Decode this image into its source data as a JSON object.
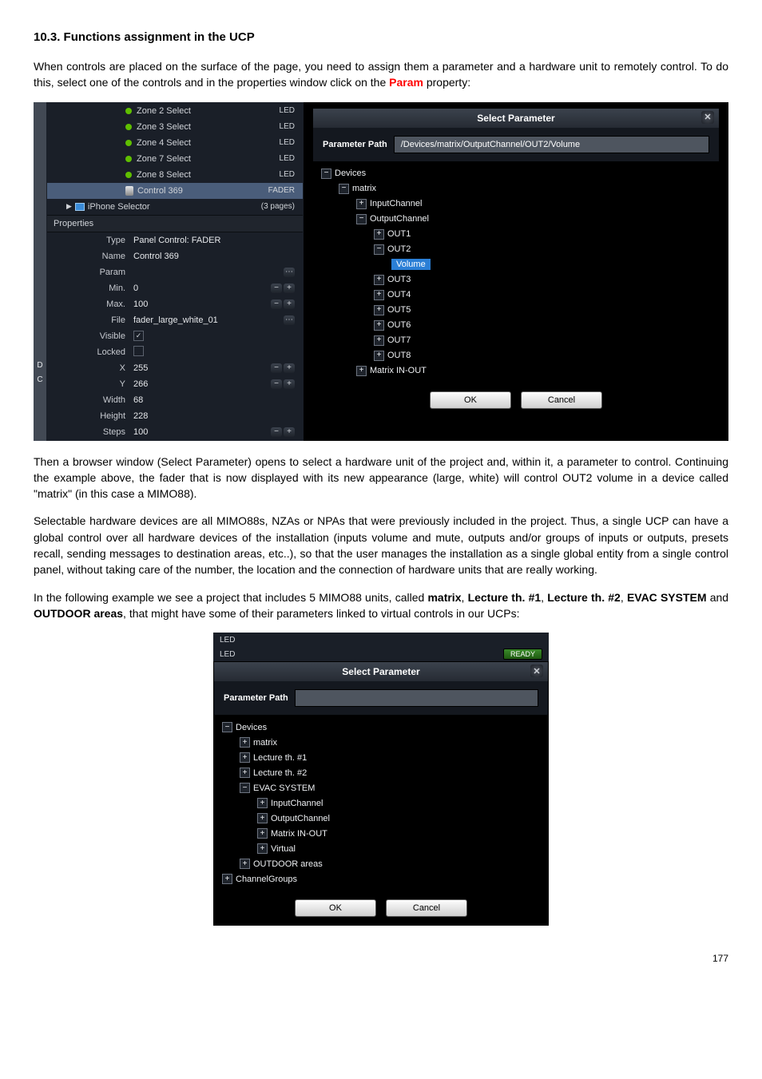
{
  "doc": {
    "heading": "10.3. Functions assignment in the UCP",
    "p1a": "When controls are placed on the surface of the page, you need to assign them a parameter and a hardware unit to remotely control. To do this, select one of the controls and in the properties window click on the ",
    "p1b": "Param",
    "p1c": " property:",
    "p2": "Then a browser window (Select Parameter) opens to select a hardware unit of the project and, within it, a parameter to control. Continuing the example above, the fader that is now displayed with its new appearance (large, white) will control OUT2 volume in a device called \"matrix\" (in this case a MIMO88).",
    "p3": "Selectable hardware devices are all MIMO88s, NZAs or NPAs that were previously included in the project. Thus, a single UCP can have a global control over all hardware devices of the installation (inputs volume and mute, outputs and/or groups of inputs or outputs, presets recall, sending messages to destination areas, etc..), so that the user manages the installation as a single global entity from a single control panel, without taking care of the number, the location and the connection of hardware units that are really working.",
    "p4a": "In the following example we see a project that includes 5 MIMO88 units, called ",
    "p4b": "matrix",
    "p4c": ", ",
    "p4d": "Lecture th. #1",
    "p4e": ", ",
    "p4f": "Lecture th. #2",
    "p4g": ", ",
    "p4h": "EVAC SYSTEM",
    "p4i": " and ",
    "p4j": "OUTDOOR areas",
    "p4k": ", that might have some of their parameters linked to virtual controls in our UCPs:",
    "page_num": "177"
  },
  "list": {
    "items": [
      {
        "label": "Zone 2 Select",
        "tag": "LED",
        "kind": "led"
      },
      {
        "label": "Zone 3 Select",
        "tag": "LED",
        "kind": "led"
      },
      {
        "label": "Zone 4 Select",
        "tag": "LED",
        "kind": "led"
      },
      {
        "label": "Zone 7 Select",
        "tag": "LED",
        "kind": "led"
      },
      {
        "label": "Zone 8 Select",
        "tag": "LED",
        "kind": "led"
      },
      {
        "label": "Control 369",
        "tag": "FADER",
        "kind": "fader",
        "selected": true
      },
      {
        "label": "iPhone Selector",
        "tag": "(3 pages)",
        "kind": "ucp"
      }
    ]
  },
  "side": {
    "d": "D",
    "c": "C"
  },
  "props": {
    "title": "Properties",
    "rows": [
      {
        "k": "Type",
        "v": "Panel Control: FADER"
      },
      {
        "k": "Name",
        "v": "Control 369"
      },
      {
        "k": "Param",
        "v": "",
        "browse": true
      },
      {
        "k": "Min.",
        "v": "0",
        "spin": true
      },
      {
        "k": "Max.",
        "v": "100",
        "spin": true
      },
      {
        "k": "File",
        "v": "fader_large_white_01",
        "browse": true
      },
      {
        "k": "Visible",
        "v": "",
        "check": true,
        "checked": true
      },
      {
        "k": "Locked",
        "v": "",
        "check": true,
        "checked": false
      },
      {
        "k": "X",
        "v": "255",
        "spin": true
      },
      {
        "k": "Y",
        "v": "266",
        "spin": true
      },
      {
        "k": "Width",
        "v": "68"
      },
      {
        "k": "Height",
        "v": "228"
      },
      {
        "k": "Steps",
        "v": "100",
        "spin": true
      }
    ]
  },
  "dialog1": {
    "title": "Select Parameter",
    "path_label": "Parameter Path",
    "path_value": "/Devices/matrix/OutputChannel/OUT2/Volume",
    "tree": [
      {
        "indent": 0,
        "sym": "−",
        "label": "Devices"
      },
      {
        "indent": 1,
        "sym": "−",
        "label": "matrix"
      },
      {
        "indent": 2,
        "sym": "+",
        "label": "InputChannel"
      },
      {
        "indent": 2,
        "sym": "−",
        "label": "OutputChannel"
      },
      {
        "indent": 3,
        "sym": "+",
        "label": "OUT1"
      },
      {
        "indent": 3,
        "sym": "−",
        "label": "OUT2"
      },
      {
        "indent": 4,
        "sym": "",
        "label": "Volume",
        "hl": true
      },
      {
        "indent": 3,
        "sym": "+",
        "label": "OUT3"
      },
      {
        "indent": 3,
        "sym": "+",
        "label": "OUT4"
      },
      {
        "indent": 3,
        "sym": "+",
        "label": "OUT5"
      },
      {
        "indent": 3,
        "sym": "+",
        "label": "OUT6"
      },
      {
        "indent": 3,
        "sym": "+",
        "label": "OUT7"
      },
      {
        "indent": 3,
        "sym": "+",
        "label": "OUT8"
      },
      {
        "indent": 2,
        "sym": "+",
        "label": "Matrix IN-OUT"
      }
    ],
    "ok": "OK",
    "cancel": "Cancel",
    "close": "✕"
  },
  "dialog2": {
    "led_tag": "LED",
    "ready": "READY",
    "title": "Select Parameter",
    "path_label": "Parameter Path",
    "tree": [
      {
        "indent": 0,
        "sym": "−",
        "label": "Devices"
      },
      {
        "indent": 1,
        "sym": "+",
        "label": "matrix"
      },
      {
        "indent": 1,
        "sym": "+",
        "label": "Lecture th. #1"
      },
      {
        "indent": 1,
        "sym": "+",
        "label": "Lecture th. #2"
      },
      {
        "indent": 1,
        "sym": "−",
        "label": "EVAC SYSTEM"
      },
      {
        "indent": 2,
        "sym": "+",
        "label": "InputChannel"
      },
      {
        "indent": 2,
        "sym": "+",
        "label": "OutputChannel"
      },
      {
        "indent": 2,
        "sym": "+",
        "label": "Matrix IN-OUT"
      },
      {
        "indent": 2,
        "sym": "+",
        "label": "Virtual"
      },
      {
        "indent": 1,
        "sym": "+",
        "label": "OUTDOOR areas"
      },
      {
        "indent": 0,
        "sym": "+",
        "label": "ChannelGroups"
      }
    ],
    "ok": "OK",
    "cancel": "Cancel",
    "close": "✕"
  }
}
